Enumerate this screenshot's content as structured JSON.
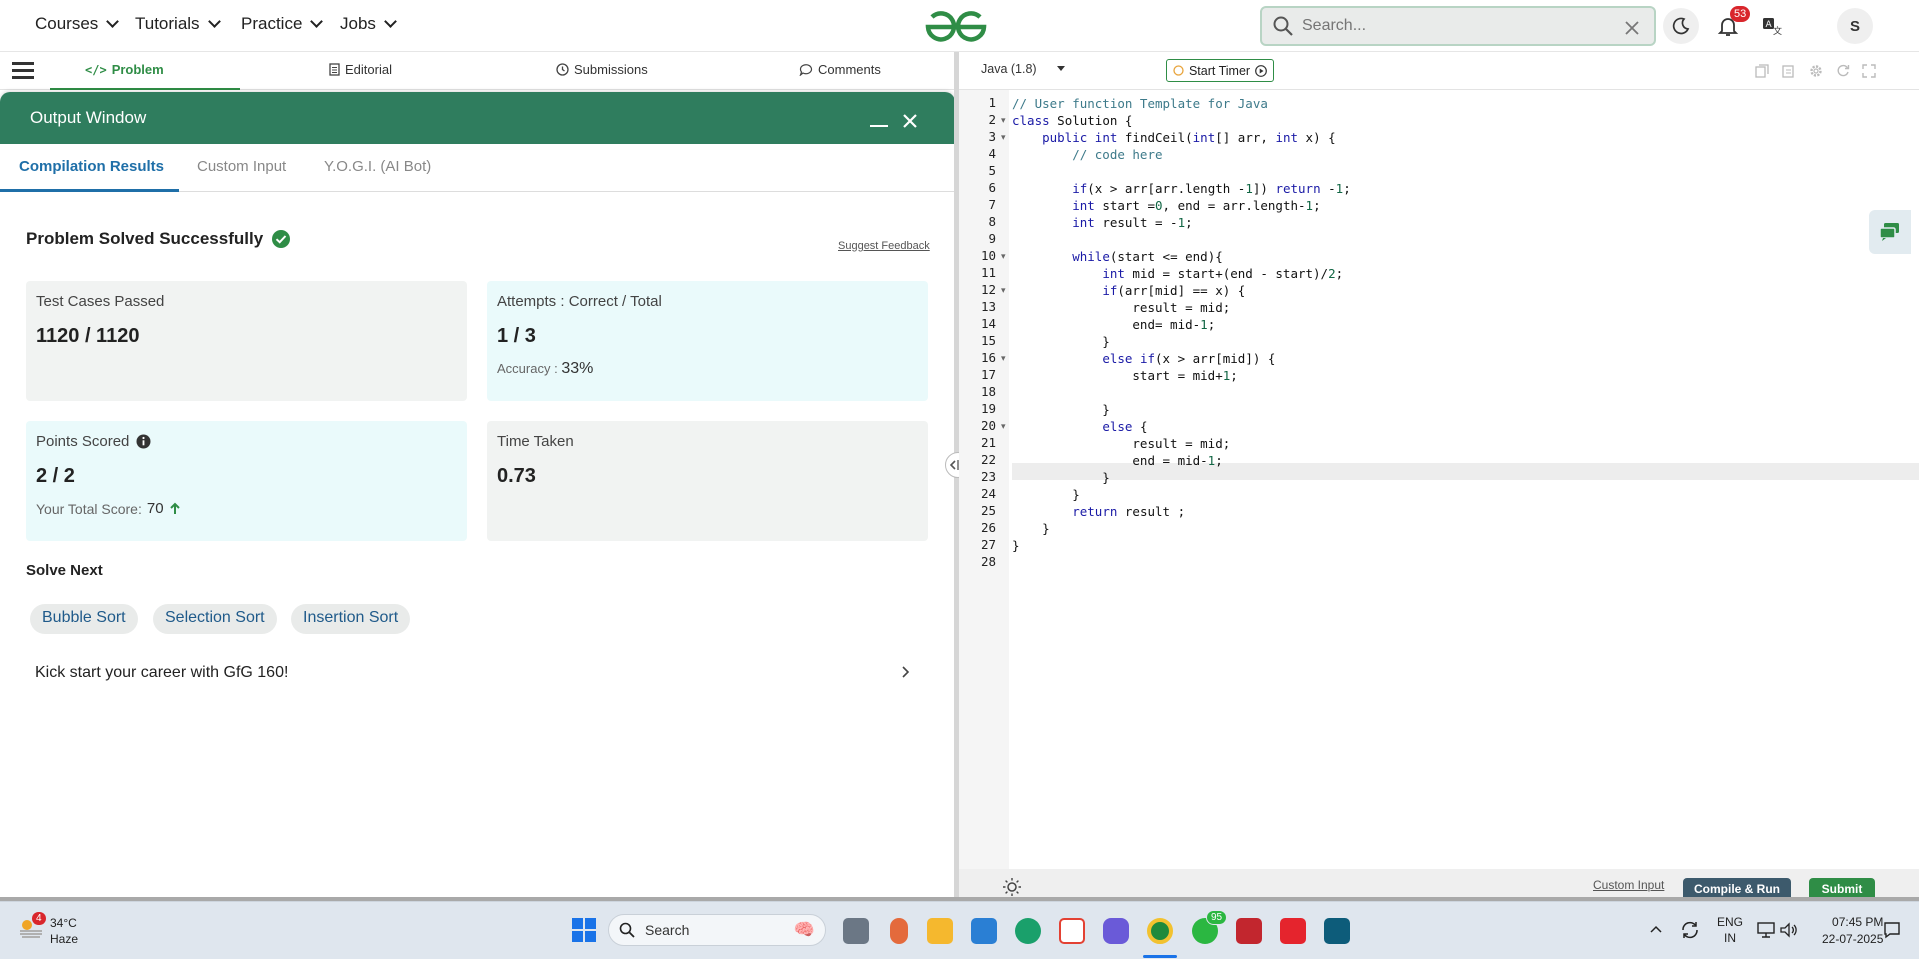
{
  "topnav": {
    "items": [
      "Courses",
      "Tutorials",
      "Practice",
      "Jobs"
    ],
    "search_placeholder": "Search...",
    "notification_count": "53",
    "avatar_letter": "S"
  },
  "problem_tabs": [
    "Problem",
    "Editorial",
    "Submissions",
    "Comments"
  ],
  "output": {
    "title": "Output Window",
    "tabs": [
      "Compilation Results",
      "Custom Input",
      "Y.O.G.I. (AI Bot)"
    ],
    "status": "Problem Solved Successfully",
    "suggest": "Suggest Feedback",
    "test_cases_label": "Test Cases Passed",
    "test_cases_value": "1120 / 1120",
    "attempts_label": "Attempts : Correct / Total",
    "attempts_value": "1 / 3",
    "accuracy_label": "Accuracy :",
    "accuracy_value": "33%",
    "points_label": "Points Scored",
    "points_value": "2 / 2",
    "total_score_label": "Your Total Score:",
    "total_score_value": "70",
    "time_label": "Time Taken",
    "time_value": "0.73",
    "solve_next_label": "Solve Next",
    "solve_next": [
      "Bubble Sort",
      "Selection Sort",
      "Insertion Sort"
    ],
    "career_text": "Kick start your career with GfG 160!"
  },
  "editor": {
    "language": "Java (1.8)",
    "timer_label": "Start Timer",
    "code_lines": [
      "// User function Template for Java",
      "class Solution {",
      "    public int findCeil(int[] arr, int x) {",
      "        // code here",
      "",
      "        if(x > arr[arr.length -1]) return -1;",
      "        int start =0, end = arr.length-1;",
      "        int result = -1;",
      "",
      "        while(start <= end){",
      "            int mid = start+(end - start)/2;",
      "            if(arr[mid] == x) {",
      "                result = mid;",
      "                end= mid-1;",
      "            }",
      "            else if(x > arr[mid]) {",
      "                start = mid+1;",
      "",
      "            }",
      "            else {",
      "                result = mid;",
      "                end = mid-1;",
      "            }",
      "        }",
      "        return result ;",
      "    }",
      "}",
      ""
    ],
    "custom_input_label": "Custom Input",
    "compile_label": "Compile & Run",
    "submit_label": "Submit"
  },
  "taskbar": {
    "weather_temp": "34°C",
    "weather_desc": "Haze",
    "weather_badge": "4",
    "search_label": "Search",
    "whatsapp_badge": "95",
    "lang_top": "ENG",
    "lang_bottom": "IN",
    "time": "07:45 PM",
    "date": "22-07-2025"
  },
  "colors": {
    "brand_green": "#2f8d46",
    "output_header": "#2f7d5e",
    "notify_red": "#d9262c",
    "card_blue": "#eafafb",
    "card_gray": "#f1f3f2"
  }
}
